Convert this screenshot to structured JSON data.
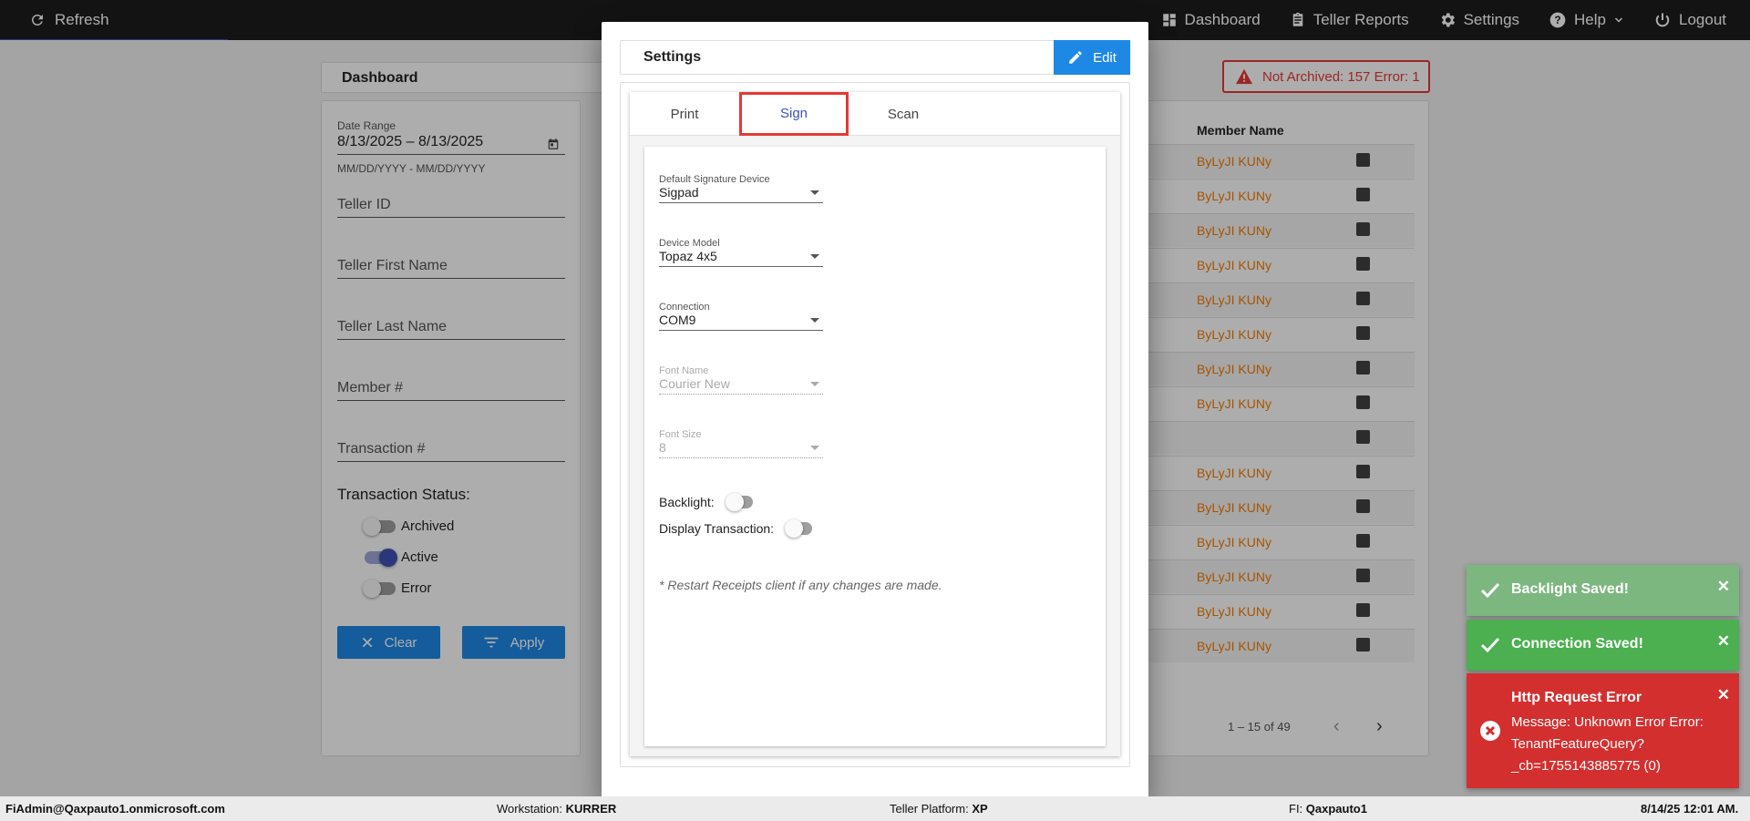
{
  "topbar": {
    "refresh_label": "Refresh",
    "nav": [
      {
        "label": "Dashboard",
        "icon": "dashboard-icon"
      },
      {
        "label": "Teller Reports",
        "icon": "clipboard-icon"
      },
      {
        "label": "Settings",
        "icon": "gear-icon"
      },
      {
        "label": "Help",
        "icon": "help-icon"
      },
      {
        "label": "Logout",
        "icon": "power-icon"
      }
    ]
  },
  "dashboard": {
    "title": "Dashboard",
    "date_range_label": "Date Range",
    "date_range_value": "8/13/2025 – 8/13/2025",
    "date_hint": "MM/DD/YYYY - MM/DD/YYYY",
    "fields": [
      "Teller ID",
      "Teller First Name",
      "Teller Last Name",
      "Member #",
      "Transaction #"
    ],
    "status_title": "Transaction Status:",
    "statuses": [
      {
        "label": "Archived",
        "on": false
      },
      {
        "label": "Active",
        "on": true
      },
      {
        "label": "Error",
        "on": false
      }
    ],
    "clear_label": "Clear",
    "apply_label": "Apply",
    "badge_text": "Not Archived: 157  Error: 1",
    "member_header": "Member Name",
    "members": [
      "ByLyJI KUNy",
      "ByLyJI KUNy",
      "ByLyJI KUNy",
      "ByLyJI KUNy",
      "ByLyJI KUNy",
      "ByLyJI KUNy",
      "ByLyJI KUNy",
      "ByLyJI KUNy",
      "",
      "ByLyJI KUNy",
      "ByLyJI KUNy",
      "ByLyJI KUNy",
      "ByLyJI KUNy",
      "ByLyJI KUNy",
      "ByLyJI KUNy"
    ],
    "pager_text": "1 – 15 of 49"
  },
  "modal": {
    "title": "Settings",
    "edit_label": "Edit",
    "tabs": [
      "Print",
      "Sign",
      "Scan"
    ],
    "active_tab": "Sign",
    "selects": [
      {
        "label": "Default Signature Device",
        "value": "Sigpad",
        "disabled": false
      },
      {
        "label": "Device Model",
        "value": "Topaz 4x5",
        "disabled": false
      },
      {
        "label": "Connection",
        "value": "COM9",
        "disabled": false
      },
      {
        "label": "Font Name",
        "value": "Courier New",
        "disabled": true
      },
      {
        "label": "Font Size",
        "value": "8",
        "disabled": true
      }
    ],
    "switches": [
      {
        "label": "Backlight:",
        "on": false
      },
      {
        "label": "Display Transaction:",
        "on": false
      }
    ],
    "note": "* Restart Receipts client if any changes are made."
  },
  "statusbar": {
    "user": "FiAdmin@Qaxpauto1.onmicrosoft.com",
    "workstation_label": "Workstation:",
    "workstation": "KURRER",
    "platform_label": "Teller Platform:",
    "platform": "XP",
    "fi_label": "FI:",
    "fi": "Qaxpauto1",
    "datetime": "8/14/25 12:01 AM."
  },
  "toasts": [
    {
      "type": "success",
      "title": "Backlight Saved!"
    },
    {
      "type": "success",
      "title": "Connection Saved!"
    },
    {
      "type": "error",
      "title": "Http Request Error",
      "message": "Message: Unknown Error Error: TenantFeatureQuery?_cb=1755143885775 (0)"
    }
  ],
  "colors": {
    "topbar": "#1d1d1d",
    "primary": "#1e88e5",
    "indigo": "#3f51b5",
    "error": "#d32f2f",
    "success": "#4caf50",
    "member_link": "#f57c00"
  }
}
